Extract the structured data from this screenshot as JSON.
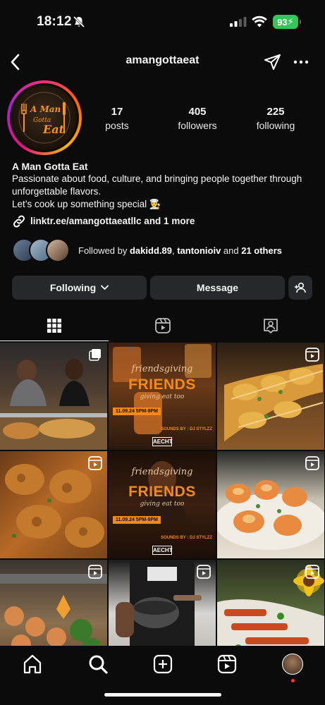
{
  "status_bar": {
    "time": "18:12",
    "battery": "93"
  },
  "header": {
    "username": "amangottaeat"
  },
  "profile": {
    "logo_text_line1": "A Man",
    "logo_text_line2": "Gotta",
    "logo_text_line3": "Eat",
    "stats": {
      "posts_count": "17",
      "posts_label": "posts",
      "followers_count": "405",
      "followers_label": "followers",
      "following_count": "225",
      "following_label": "following"
    },
    "bio": {
      "name": "A Man Gotta Eat",
      "line1": "Passionate about food, culture, and bringing people together through",
      "line2": "unforgettable flavors.",
      "line3": "Let’s cook up something special 👨‍🍳",
      "link": "linktr.ee/amangottaeatllc and 1 more"
    },
    "followed_by": {
      "prefix": "Followed by ",
      "user1": "dakidd.89",
      "sep": ", ",
      "user2": "tantonioiv",
      "and": " and ",
      "others": "21 others"
    }
  },
  "actions": {
    "following_label": "Following",
    "message_label": "Message"
  },
  "flyers": {
    "script_title": "friendsgiving",
    "big_title": "FRIENDS",
    "subtitle": "giving eat too",
    "date": "11.09.24 5PM-9PM",
    "sounds": "SOUNDS BY : DJ STYLZZ",
    "logo": "AECHT"
  },
  "colors": {
    "accent_orange": "#f28a1a",
    "battery_green": "#33c759",
    "notif_red": "#ff3040"
  }
}
